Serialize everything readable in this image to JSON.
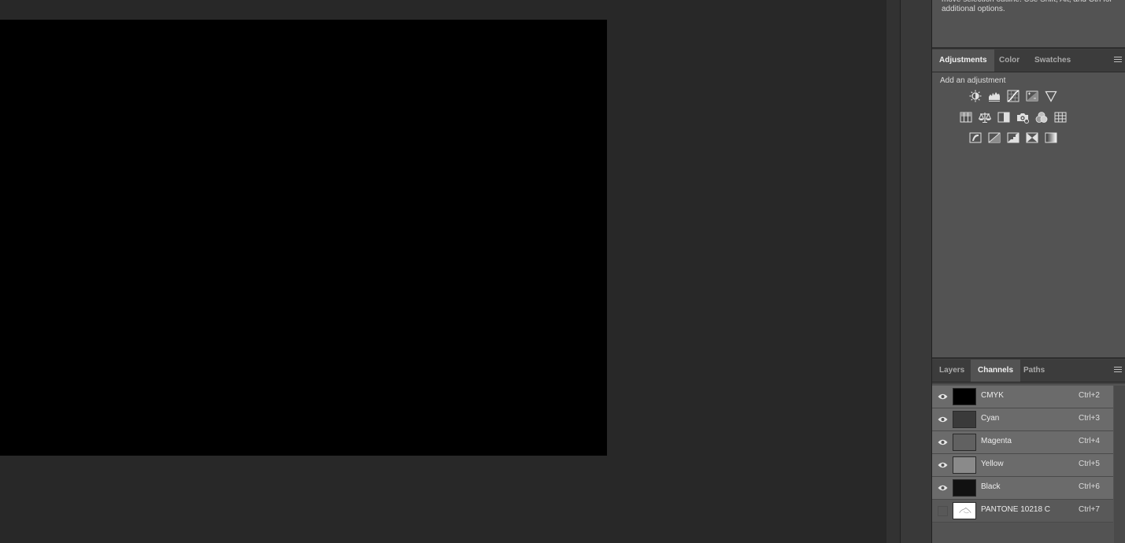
{
  "info": {
    "text": "move selection outline. Use Shift, Alt, and Ctrl for additional options."
  },
  "adjustments_panel": {
    "tabs": [
      {
        "label": "Adjustments",
        "active": true
      },
      {
        "label": "Color",
        "active": false
      },
      {
        "label": "Swatches",
        "active": false
      }
    ],
    "title": "Add an adjustment",
    "icons": [
      [
        "brightness-contrast-icon",
        "levels-icon",
        "curves-icon",
        "exposure-icon",
        "vibrance-icon"
      ],
      [
        "hue-saturation-icon",
        "color-balance-icon",
        "black-white-icon",
        "photo-filter-icon",
        "channel-mixer-icon",
        "color-lookup-icon"
      ],
      [
        "invert-icon",
        "posterize-icon",
        "threshold-icon",
        "selective-color-icon",
        "gradient-map-icon"
      ]
    ]
  },
  "channels_panel": {
    "tabs": [
      {
        "label": "Layers",
        "active": false
      },
      {
        "label": "Channels",
        "active": true
      },
      {
        "label": "Paths",
        "active": false
      }
    ],
    "channels": [
      {
        "name": "CMYK",
        "shortcut": "Ctrl+2",
        "visible": true,
        "thumb_color": "#000000"
      },
      {
        "name": "Cyan",
        "shortcut": "Ctrl+3",
        "visible": true,
        "thumb_color": "#3a3a3a"
      },
      {
        "name": "Magenta",
        "shortcut": "Ctrl+4",
        "visible": true,
        "thumb_color": "#616161"
      },
      {
        "name": "Yellow",
        "shortcut": "Ctrl+5",
        "visible": true,
        "thumb_color": "#8a8a8a"
      },
      {
        "name": "Black",
        "shortcut": "Ctrl+6",
        "visible": true,
        "thumb_color": "#111111"
      },
      {
        "name": "PANTONE 10218 C",
        "shortcut": "Ctrl+7",
        "visible": false,
        "thumb_color": "#ffffff"
      }
    ]
  }
}
